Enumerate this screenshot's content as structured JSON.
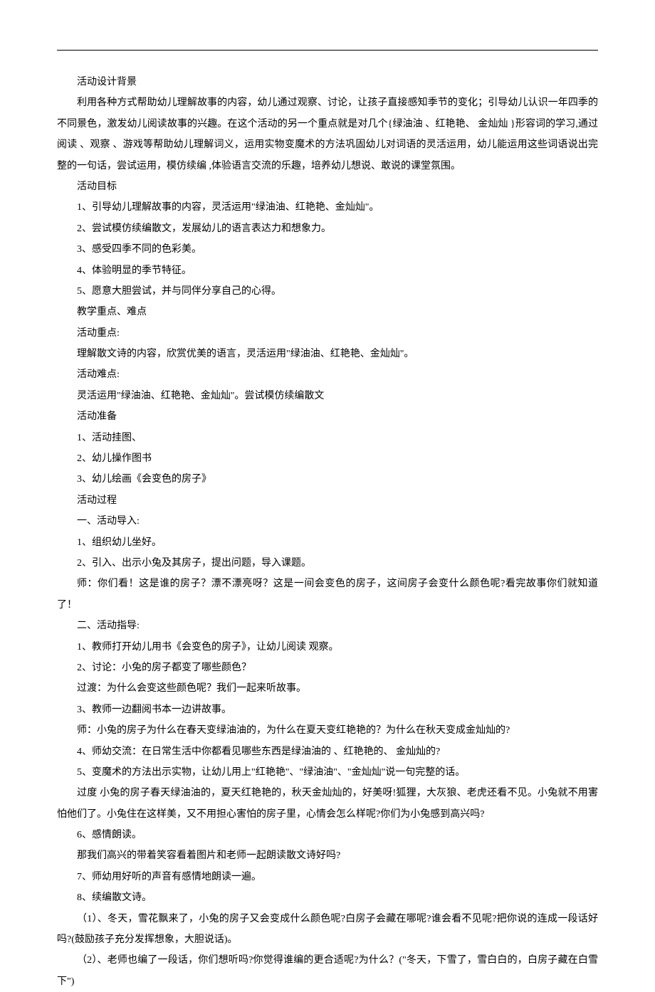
{
  "lines": [
    "活动设计背景",
    "利用各种方式帮助幼儿理解故事的内容，幼儿通过观察、讨论，让孩子直接感知季节的变化；引导幼儿认识一年四季的不同景色，激发幼儿阅读故事的兴趣。在这个活动的另一个重点就是对几个{绿油油 、红艳艳、  金灿灿 }形容词的学习,通过阅读 、观察 、游戏等帮助幼儿理解词义，运用实物变魔术的方法巩固幼儿对词语的灵活运用，幼儿能运用这些词语说出完整的一句话，尝试运用，模仿续编 ,体验语言交流的乐趣，培养幼儿想说、敢说的课堂氛围。",
    "活动目标",
    "1、引导幼儿理解故事的内容，灵活运用\"绿油油、红艳艳、金灿灿\"。",
    "2、尝试模仿续编散文，发展幼儿的语言表达力和想象力。",
    "3、感受四季不同的色彩美。",
    "4、体验明显的季节特征。",
    "5、愿意大胆尝试，并与同伴分享自己的心得。",
    "教学重点、难点",
    "活动重点:",
    "理解散文诗的内容，欣赏优美的语言，灵活运用\"绿油油、红艳艳、金灿灿\"。",
    "活动难点:",
    "灵活运用\"绿油油、红艳艳、金灿灿\"。尝试模仿续编散文",
    "活动准备",
    "1、活动挂图、",
    "2、幼儿操作图书",
    "3、幼儿绘画《会变色的房子》",
    "活动过程",
    "一、活动导入:",
    "1、组织幼儿坐好。",
    "2、引入、出示小兔及其房子，提出问题，导入课题。",
    "师：你们看！这是谁的房子？漂不漂亮呀？这是一间会变色的房子，这间房子会变什么颜色呢?看完故事你们就知道了！",
    "二、活动指导:",
    "1、教师打开幼儿用书《会变色的房子》，让幼儿阅读 观察。",
    "2、讨论：小兔的房子都变了哪些颜色？",
    "过渡：为什么会变这些颜色呢？我们一起来听故事。",
    "3、教师一边翻阅书本一边讲故事。",
    "师：小兔的房子为什么在春天变绿油油的，为什么在夏天变红艳艳的？为什么在秋天变成金灿灿的?",
    "4、师幼交流：在日常生活中你都看见哪些东西是绿油油的 、红艳艳的、  金灿灿的?",
    "5、变魔术的方法出示实物，让幼儿用上\"红艳艳\"、\"绿油油\"、\"金灿灿\"说一句完整的话。",
    "过度 小兔的房子春天绿油油的，夏天红艳艳的，秋天金灿灿的，好美呀!狐狸，大灰狼、老虎还看不见。小兔就不用害怕他们了。小兔住在这样美，又不用担心害怕的房子里，心情会怎么样呢?你们为小兔感到高兴吗?",
    "6、感情朗读。",
    "那我们高兴的带着笑容看着图片和老师一起朗读散文诗好吗?",
    "7、师幼用好听的声音有感情地朗读一遍。",
    "8、续编散文诗。",
    "（1）、冬天，雪花飘来了，小兔的房子又会变成什么颜色呢?白房子会藏在哪呢?谁会看不见呢?把你说的连成一段话好吗?(鼓励孩子充分发挥想象，大胆说话)。",
    "（2）、老师也编了一段话，你们想听吗?你觉得谁编的更合适呢?为什么？(\"冬天，下雪了，雪白白的，白房子藏在白雪下\")"
  ]
}
